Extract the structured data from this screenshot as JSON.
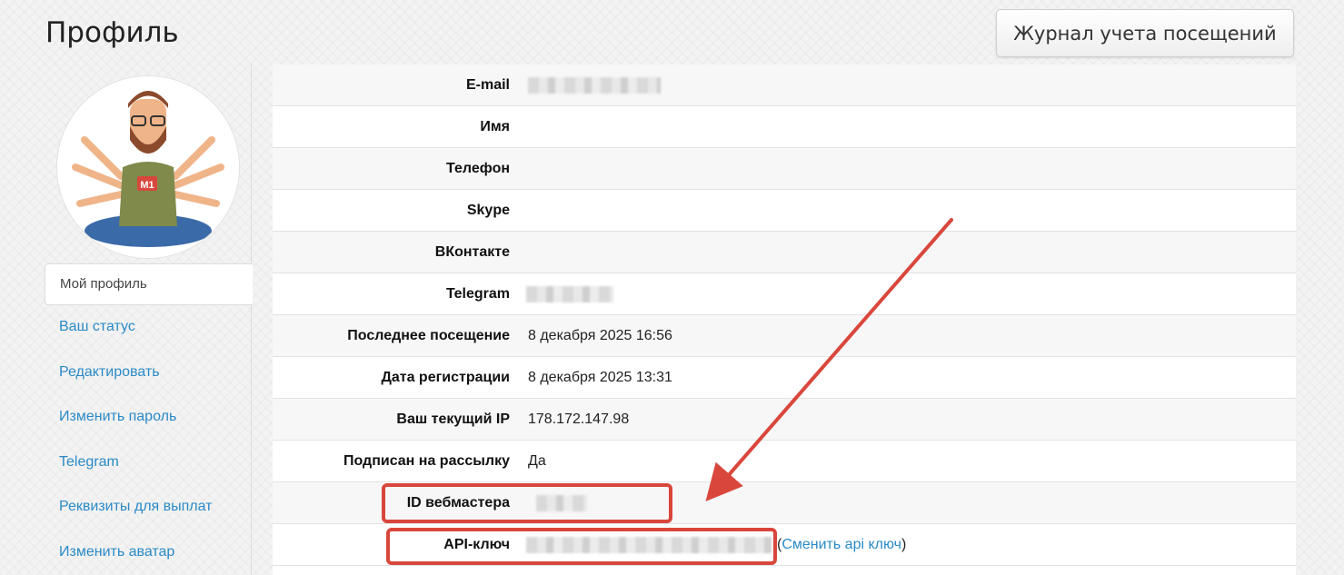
{
  "page": {
    "title": "Профиль",
    "visit_log_button": "Журнал учета посещений"
  },
  "sidebar": {
    "avatar_badge": "M1",
    "active_item": "Мой профиль",
    "items": [
      {
        "label": "Ваш статус"
      },
      {
        "label": "Редактировать"
      },
      {
        "label": "Изменить пароль"
      },
      {
        "label": "Telegram"
      },
      {
        "label": "Реквизиты для выплат"
      },
      {
        "label": "Изменить аватар"
      }
    ]
  },
  "profile": {
    "rows": [
      {
        "label": "E-mail",
        "value": "",
        "redacted": true
      },
      {
        "label": "Имя",
        "value": ""
      },
      {
        "label": "Телефон",
        "value": ""
      },
      {
        "label": "Skype",
        "value": ""
      },
      {
        "label": "ВКонтакте",
        "value": ""
      },
      {
        "label": "Telegram",
        "value": "",
        "redacted": true
      },
      {
        "label": "Последнее посещение",
        "value": "8 декабря 2025 16:56"
      },
      {
        "label": "Дата регистрации",
        "value": "8 декабря 2025 13:31"
      },
      {
        "label": "Ваш текущий IP",
        "value": "178.172.147.98"
      },
      {
        "label": "Подписан на рассылку",
        "value": "Да"
      },
      {
        "label": "ID вебмастера",
        "value": "",
        "redacted": true
      },
      {
        "label": "API-ключ",
        "value": "",
        "redacted": true
      }
    ],
    "api_change_prefix": "(",
    "api_change_link": "Сменить api ключ",
    "api_change_suffix": ")"
  },
  "annotation": {
    "highlight_color": "#d9473c"
  }
}
